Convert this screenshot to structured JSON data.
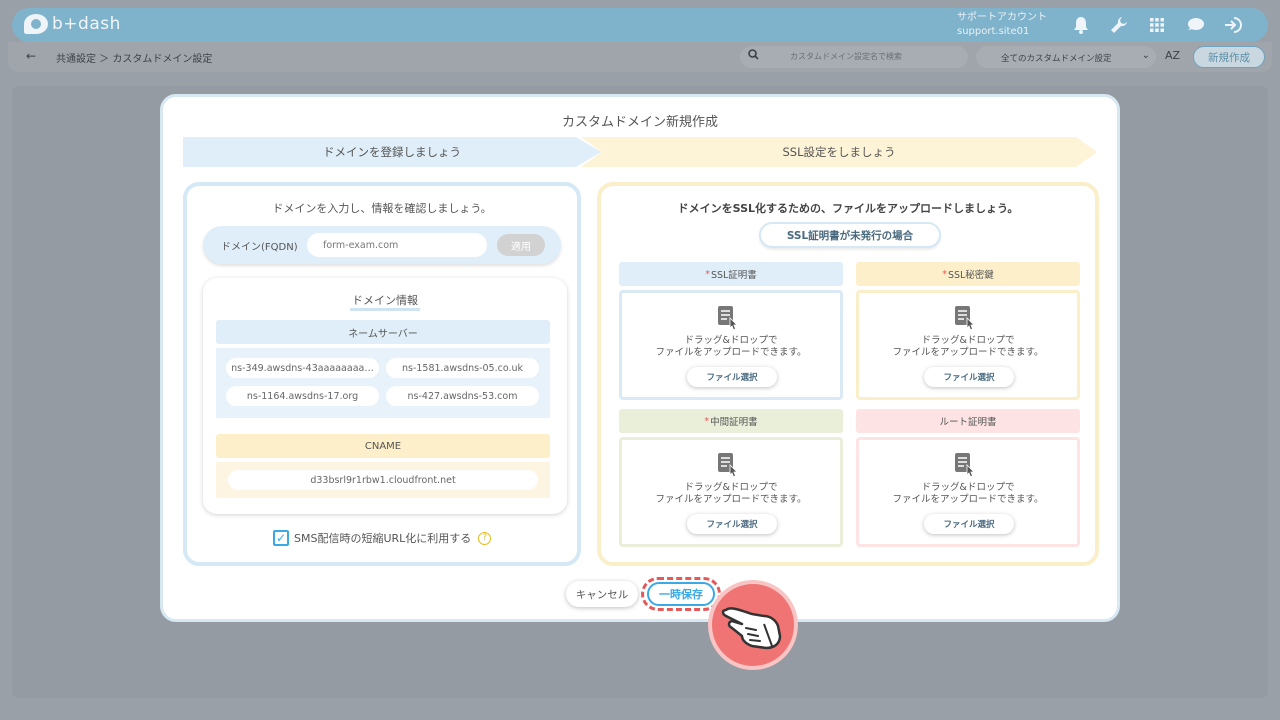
{
  "appbar": {
    "logo_text": "b+dash",
    "account_label": "サポートアカウント",
    "account_id": "support.site01",
    "icons": [
      "bell-icon",
      "wrench-icon",
      "grid-icon",
      "chat-icon",
      "logout-icon"
    ]
  },
  "toolbar": {
    "breadcrumb": "共通設定 ＞ カスタムドメイン設定",
    "search_placeholder": "カスタムドメイン設定名で検索",
    "filter_value": "全てのカスタムドメイン設定",
    "sort_label": "AZ",
    "new_label": "新規作成"
  },
  "modal": {
    "title": "カスタムドメイン新規作成",
    "steps": [
      "ドメインを登録しましょう",
      "SSL設定をしましょう"
    ],
    "left": {
      "heading": "ドメインを入力し、情報を確認しましょう。",
      "domain_label": "ドメイン(FQDN)",
      "domain_value": "form-exam.com",
      "apply_label": "適用",
      "info_title": "ドメイン情報",
      "ns_header": "ネームサーバー",
      "nameservers": [
        "ns-349.awsdns-43aaaaaaaa…",
        "ns-1581.awsdns-05.co.uk",
        "ns-1164.awsdns-17.org",
        "ns-427.awsdns-53.com"
      ],
      "cname_header": "CNAME",
      "cname_value": "d33bsrl9r1rbw1.cloudfront.net",
      "sms_label": "SMS配信時の短縮URL化に利用する",
      "sms_checked": true
    },
    "right": {
      "heading": "ドメインをSSL化するための、ファイルをアップロードしましょう。",
      "unissued_label": "SSL証明書が未発行の場合",
      "drop_line1": "ドラッグ&ドロップで",
      "drop_line2": "ファイルをアップロードできます。",
      "file_select_label": "ファイル選択",
      "certs": [
        {
          "label": "SSL証明書",
          "required": true
        },
        {
          "label": "SSL秘密鍵",
          "required": true
        },
        {
          "label": "中間証明書",
          "required": true
        },
        {
          "label": "ルート証明書",
          "required": false
        }
      ],
      "required_mark": "*"
    },
    "footer": {
      "cancel_label": "キャンセル",
      "save_label": "一時保存"
    }
  },
  "colors": {
    "accent": "#3aa9e6",
    "highlight": "#e45a5a",
    "appbar": "#7fb2cb"
  }
}
